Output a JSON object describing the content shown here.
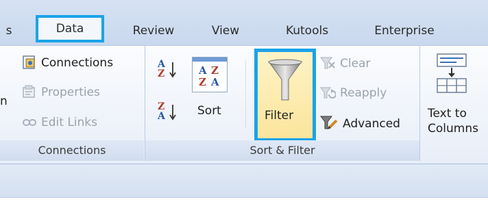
{
  "tabs": {
    "partial": "s",
    "data": "Data",
    "review": "Review",
    "view": "View",
    "kutools": "Kutools",
    "enterprise": "Enterprise"
  },
  "connections_group": {
    "connections": "Connections",
    "properties": "Properties",
    "edit_links": "Edit Links",
    "partial_left": "n",
    "label": "Connections"
  },
  "sort_filter_group": {
    "sort": "Sort",
    "filter": "Filter",
    "clear": "Clear",
    "reapply": "Reapply",
    "advanced": "Advanced",
    "label": "Sort & Filter",
    "az_top": "A",
    "az_bottom": "Z",
    "za_top": "Z",
    "za_bottom": "A",
    "sort_a1": "A",
    "sort_z1": "Z",
    "sort_z2": "Z",
    "sort_a2": "A"
  },
  "data_tools_group": {
    "text_to_line1": "Text to",
    "text_to_line2": "Columns"
  },
  "colors": {
    "highlight": "#1aa3e8",
    "filter_active": "#fbe59c"
  }
}
